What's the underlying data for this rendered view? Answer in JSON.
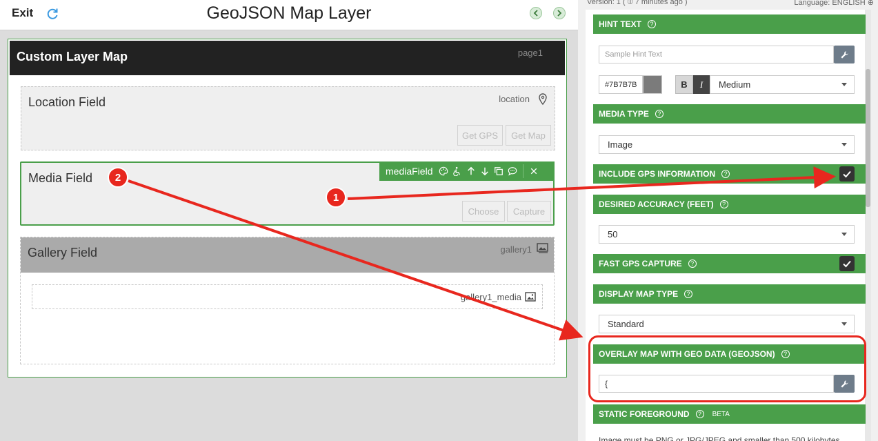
{
  "header": {
    "exit_label": "Exit",
    "title": "GeoJSON Map Layer"
  },
  "page": {
    "title": "Custom Layer Map",
    "id": "page1"
  },
  "fields": {
    "location": {
      "title": "Location Field",
      "id": "location",
      "btn_gps": "Get GPS",
      "btn_map": "Get Map"
    },
    "media": {
      "title": "Media Field",
      "id": "mediaField",
      "btn_choose": "Choose",
      "btn_capture": "Capture"
    },
    "gallery": {
      "title": "Gallery Field",
      "id": "gallery1",
      "media_id": "gallery1_media"
    }
  },
  "props": {
    "version": "Version: 1 ( ⦶ 7 minutes ago )",
    "language": "Language: ENGLISH",
    "hint_text": {
      "label": "HINT TEXT",
      "placeholder": "Sample Hint Text"
    },
    "color": {
      "value": "#7B7B7B",
      "swatch": "#7B7B7B"
    },
    "bold": "B",
    "italic": "I",
    "size": "Medium",
    "media_type": {
      "label": "MEDIA TYPE",
      "value": "Image"
    },
    "include_gps": {
      "label": "INCLUDE GPS INFORMATION",
      "checked": true
    },
    "accuracy": {
      "label": "DESIRED ACCURACY (FEET)",
      "value": "50"
    },
    "fast_gps": {
      "label": "FAST GPS CAPTURE",
      "checked": true
    },
    "map_type": {
      "label": "DISPLAY MAP TYPE",
      "value": "Standard"
    },
    "overlay": {
      "label": "OVERLAY MAP WITH GEO DATA (GEOJSON)",
      "value": "{"
    },
    "static_fg": {
      "label": "STATIC FOREGROUND",
      "beta": "BETA",
      "note": "Image must be PNG or JPG/JPEG and smaller than 500 kilobytes"
    }
  },
  "annotations": {
    "badge_1": "1",
    "badge_2": "2",
    "color": "#e8271e"
  },
  "colors": {
    "accent": "#4a9f4a",
    "header_dark": "#222222"
  }
}
